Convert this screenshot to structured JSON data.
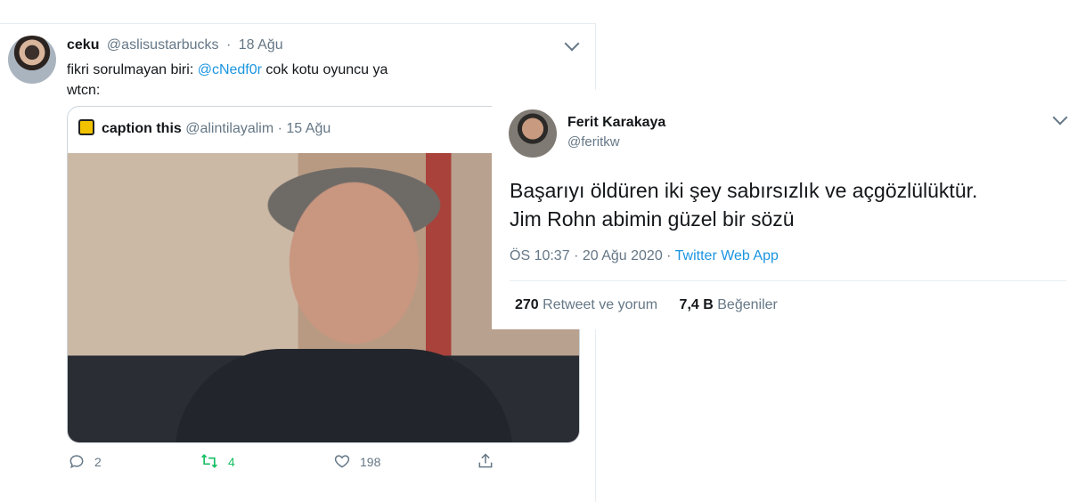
{
  "left_tweet": {
    "author_name": "ceku",
    "author_handle": "@aslisustarbucks",
    "separator": "·",
    "date": "18 Ağu",
    "text_prefix": "fikri sorulmayan biri: ",
    "mention": "@cNedf0r",
    "text_suffix": " cok kotu oyuncu ya",
    "text_line2": "wtcn:",
    "quoted": {
      "author_name": "caption this",
      "author_handle": "@alintilayalim",
      "separator": "·",
      "date": "15 Ağu"
    },
    "actions": {
      "replies": "2",
      "retweets": "4",
      "likes": "198"
    }
  },
  "right_tweet": {
    "author_name": "Ferit Karakaya",
    "author_handle": "@feritkw",
    "text_line1": "Başarıyı öldüren iki şey sabırsızlık ve açgözlülüktür.",
    "text_line2": "Jim Rohn abimin güzel bir sözü",
    "time": "ÖS 10:37",
    "separator": "·",
    "date": "20 Ağu 2020",
    "separator2": "·",
    "source": "Twitter Web App",
    "retweet_count": "270",
    "retweet_label": "Retweet ve yorum",
    "like_count": "7,4 B",
    "like_label": "Beğeniler"
  },
  "colors": {
    "link": "#1b95e0",
    "retweet": "#17bf63",
    "muted": "#657786"
  },
  "icons": [
    "reply-icon",
    "retweet-icon",
    "like-icon",
    "share-icon",
    "chevron-down-icon"
  ]
}
